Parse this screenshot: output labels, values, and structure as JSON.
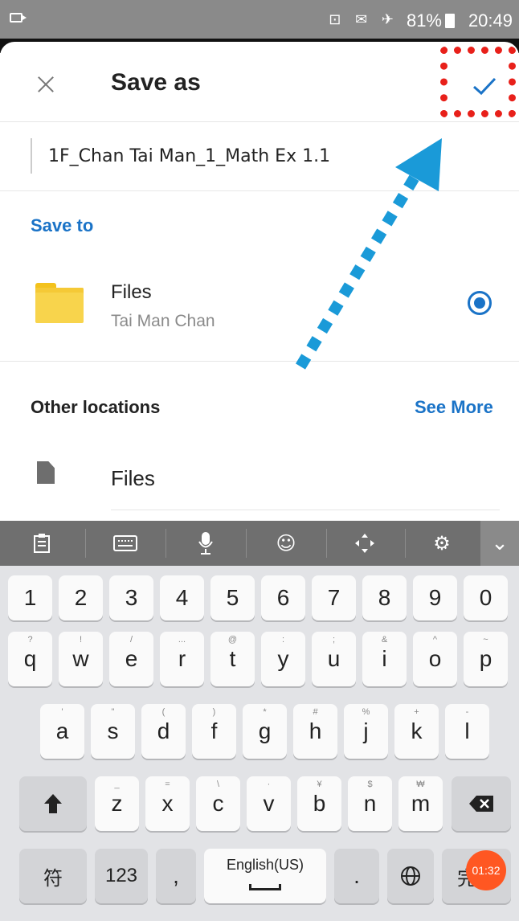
{
  "status_bar": {
    "icons": "⊡ ✉ ✈",
    "battery": "81%",
    "time": "20:49"
  },
  "header": {
    "title": "Save as",
    "close_icon": "close-icon",
    "confirm_icon": "check-icon"
  },
  "filename": {
    "value": "1F_Chan Tai Man_1_Math Ex 1.1"
  },
  "save_to": {
    "label": "Save to",
    "location_name": "Files",
    "location_owner": "Tai Man Chan",
    "selected": true
  },
  "other_locations": {
    "label": "Other locations",
    "see_more": "See More",
    "items": [
      {
        "name": "Files"
      }
    ]
  },
  "annotations": {
    "highlight_color": "#e8201a",
    "arrow_color": "#1a9ad8"
  },
  "keyboard": {
    "toolbar": [
      "clipboard-icon",
      "keyboard-icon",
      "microphone-icon",
      "emoji-icon",
      "cursor-move-icon",
      "settings-icon",
      "chevron-down-icon"
    ],
    "number_row": [
      "1",
      "2",
      "3",
      "4",
      "5",
      "6",
      "7",
      "8",
      "9",
      "0"
    ],
    "row1": [
      {
        "key": "q",
        "hint": "?"
      },
      {
        "key": "w",
        "hint": "!"
      },
      {
        "key": "e",
        "hint": "/"
      },
      {
        "key": "r",
        "hint": "..."
      },
      {
        "key": "t",
        "hint": "@"
      },
      {
        "key": "y",
        "hint": ":"
      },
      {
        "key": "u",
        "hint": ";"
      },
      {
        "key": "i",
        "hint": "&"
      },
      {
        "key": "o",
        "hint": "^"
      },
      {
        "key": "p",
        "hint": "~"
      }
    ],
    "row2": [
      {
        "key": "a",
        "hint": "'"
      },
      {
        "key": "s",
        "hint": "\""
      },
      {
        "key": "d",
        "hint": "("
      },
      {
        "key": "f",
        "hint": ")"
      },
      {
        "key": "g",
        "hint": "*"
      },
      {
        "key": "h",
        "hint": "#"
      },
      {
        "key": "j",
        "hint": "%"
      },
      {
        "key": "k",
        "hint": "+"
      },
      {
        "key": "l",
        "hint": "-"
      }
    ],
    "row3": [
      {
        "key": "z",
        "hint": "_"
      },
      {
        "key": "x",
        "hint": "="
      },
      {
        "key": "c",
        "hint": "\\"
      },
      {
        "key": "v",
        "hint": "·"
      },
      {
        "key": "b",
        "hint": "¥"
      },
      {
        "key": "n",
        "hint": "$"
      },
      {
        "key": "m",
        "hint": "₩"
      }
    ],
    "bottom": {
      "symbols": "符",
      "numbers": "123",
      "comma": ",",
      "space": "English(US)",
      "period": ".",
      "globe_icon": "globe-icon",
      "done": "完成"
    },
    "timer_badge": "01:32"
  }
}
